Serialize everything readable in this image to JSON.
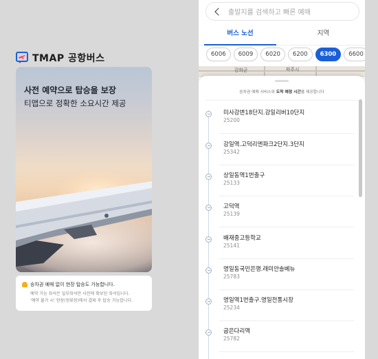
{
  "brand": {
    "name": "TMAP 공항버스"
  },
  "hero": {
    "title": "사전 예약으로 탑승을 보장",
    "subtitle": "티맵으로 정확한 소요시간 제공"
  },
  "notice": {
    "headline": "승차권 예매 없이 현장 탑승도 가능합니다.",
    "line1": "예약 가능 좌석은 일부좌석만 사전에 확보된 좌석입니다.",
    "line2": "'예약 불가 시' 현장(정류장)에서 결제 후 탑승 가능합니다."
  },
  "search": {
    "placeholder": "출발지를 검색하고 빠른 예매"
  },
  "tabs": [
    {
      "label": "버스 노선",
      "active": true
    },
    {
      "label": "지역",
      "active": false
    }
  ],
  "routes": [
    {
      "label": "6006",
      "active": false
    },
    {
      "label": "6009",
      "active": false
    },
    {
      "label": "6020",
      "active": false
    },
    {
      "label": "6200",
      "active": false
    },
    {
      "label": "6300",
      "active": true
    },
    {
      "label": "6600",
      "active": false
    }
  ],
  "map": {
    "labels": [
      "강화군",
      "파주시"
    ]
  },
  "sheet": {
    "info_prefix": "승차권 예매 서비스와 ",
    "info_bold": "도착 예정 시간",
    "info_suffix": "을 제공합니다"
  },
  "stops": [
    {
      "name": "미사강변18단지.강일리버10단지",
      "id": "25200"
    },
    {
      "name": "강일역.고덕리엔파크2단지.3단지",
      "id": "25342"
    },
    {
      "name": "상일동역1번출구",
      "id": "25133"
    },
    {
      "name": "고덕역",
      "id": "25139"
    },
    {
      "name": "배재중고등학교",
      "id": "25141"
    },
    {
      "name": "명일동국민은행.래미안솔베뉴",
      "id": "25783"
    },
    {
      "name": "명일역1번출구.명일전통시장",
      "id": "25234"
    },
    {
      "name": "굽은다리역",
      "id": "25782"
    }
  ],
  "colors": {
    "accent": "#1a5fd8",
    "notice_bell": "#f2b01e"
  }
}
